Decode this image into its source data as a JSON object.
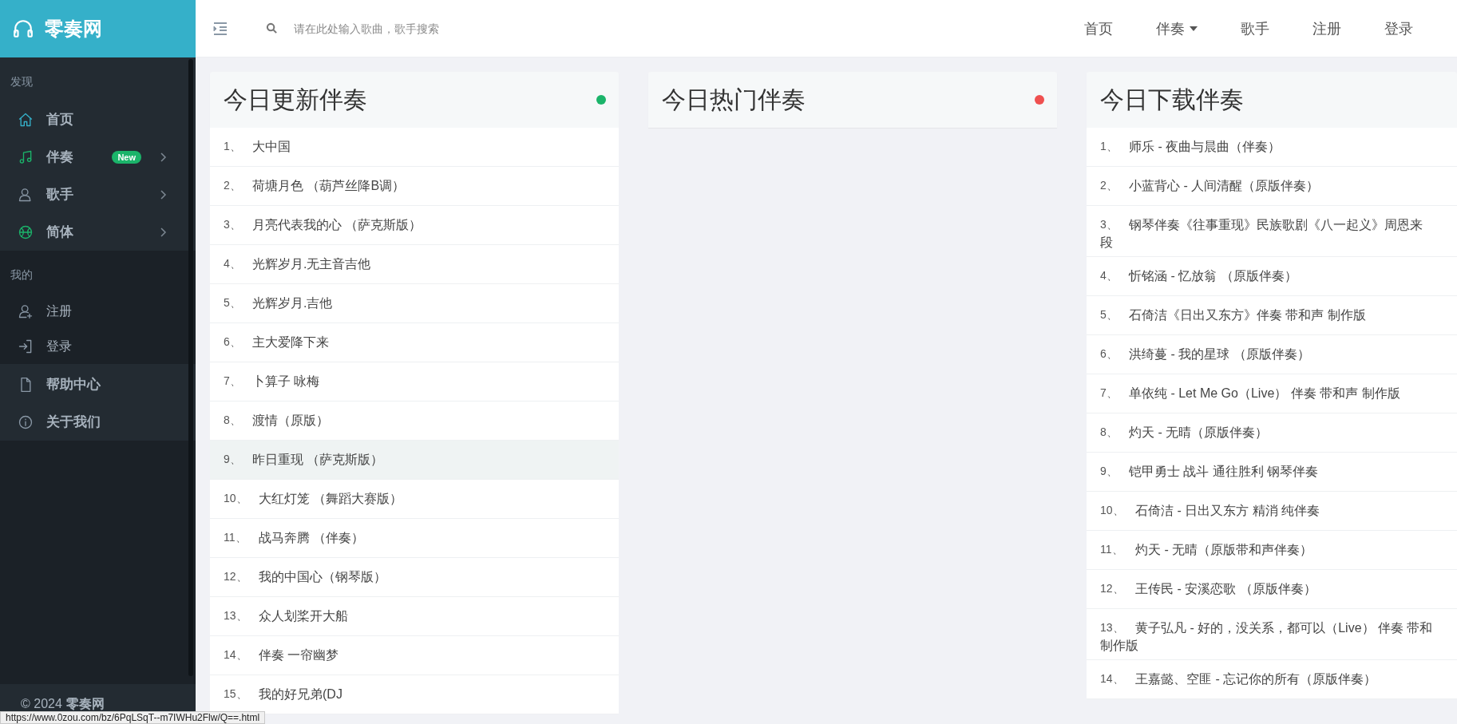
{
  "brand": {
    "name": "零奏网"
  },
  "sidebar": {
    "groups": [
      {
        "kind": "primary",
        "label": "发现",
        "items": [
          {
            "label": "首页",
            "has_submenu": false
          },
          {
            "label": "伴奏",
            "badge": "New",
            "has_submenu": true
          },
          {
            "label": "歌手",
            "has_submenu": true
          },
          {
            "label": "简体",
            "has_submenu": true
          }
        ]
      },
      {
        "kind": "secondary",
        "label": "我的",
        "items": [
          {
            "label": "注册",
            "has_submenu": false
          },
          {
            "label": "登录",
            "has_submenu": false
          }
        ]
      },
      {
        "kind": "primary",
        "items": [
          {
            "label": "帮助中心",
            "has_submenu": false
          },
          {
            "label": "关于我们",
            "has_submenu": false
          }
        ]
      }
    ],
    "footer": {
      "text": "© 2024",
      "brand": "零奏网"
    }
  },
  "header": {
    "search": {
      "placeholder": "请在此处输入歌曲，歌手搜索"
    },
    "nav": [
      {
        "label": "首页",
        "dropdown": false
      },
      {
        "label": "伴奏",
        "dropdown": true
      },
      {
        "label": "歌手",
        "dropdown": false
      },
      {
        "label": "注册",
        "dropdown": false
      },
      {
        "label": "登录",
        "dropdown": false
      }
    ]
  },
  "panels": [
    {
      "title": "今日更新伴奏",
      "color": "#1bb46a",
      "items": [
        {
          "number": "1、",
          "lines": [
            "大中国"
          ],
          "selected": false
        },
        {
          "number": "2、",
          "lines": [
            "荷塘月色 （葫芦丝降B调）"
          ],
          "selected": false
        },
        {
          "number": "3、",
          "lines": [
            "月亮代表我的心 （萨克斯版）"
          ],
          "selected": false
        },
        {
          "number": "4、",
          "lines": [
            "光辉岁月.无主音吉他"
          ],
          "selected": false
        },
        {
          "number": "5、",
          "lines": [
            "光辉岁月.吉他"
          ],
          "selected": false
        },
        {
          "number": "6、",
          "lines": [
            "主大爱降下来"
          ],
          "selected": false
        },
        {
          "number": "7、",
          "lines": [
            "卜算子 咏梅"
          ],
          "selected": false
        },
        {
          "number": "8、",
          "lines": [
            "渡情（原版）"
          ],
          "selected": false
        },
        {
          "number": "9、",
          "lines": [
            "昨日重现 （萨克斯版）"
          ],
          "selected": true
        },
        {
          "number": "10、",
          "lines": [
            "大红灯笼 （舞蹈大赛版）"
          ],
          "selected": false
        },
        {
          "number": "11、",
          "lines": [
            "战马奔腾 （伴奏）"
          ],
          "selected": false
        },
        {
          "number": "12、",
          "lines": [
            "我的中国心（钢琴版）"
          ],
          "selected": false
        },
        {
          "number": "13、",
          "lines": [
            "众人划桨开大船"
          ],
          "selected": false
        },
        {
          "number": "14、",
          "lines": [
            "伴奏 一帘幽梦"
          ],
          "selected": false
        },
        {
          "number": "15、",
          "lines": [
            "我的好兄弟(DJ"
          ],
          "selected": false
        }
      ]
    },
    {
      "title": "今日热门伴奏",
      "color": "#ef5050"
    },
    {
      "title": "今日下载伴奏",
      "items": [
        {
          "number": "1、",
          "lines": [
            "师乐 - 夜曲与晨曲（伴奏）"
          ],
          "selected": false
        },
        {
          "number": "2、",
          "lines": [
            "小蓝背心 - 人间清醒（原版伴奏）"
          ],
          "selected": false
        },
        {
          "number": "3、",
          "lines": [
            "钢琴伴奏《往事重现》民族歌剧《八一起义》周恩来",
            "段"
          ],
          "selected": false
        },
        {
          "number": "4、",
          "lines": [
            "忻铭涵 - 忆放翁 （原版伴奏）"
          ],
          "selected": false
        },
        {
          "number": "5、",
          "lines": [
            "石倚洁《日出又东方》伴奏 带和声 制作版"
          ],
          "selected": false
        },
        {
          "number": "6、",
          "lines": [
            "洪绮蔓 - 我的星球 （原版伴奏）"
          ],
          "selected": false
        },
        {
          "number": "7、",
          "lines": [
            "单依纯 - Let Me Go（Live） 伴奏 带和声 制作版"
          ],
          "selected": false
        },
        {
          "number": "8、",
          "lines": [
            "灼天 - 无晴（原版伴奏）"
          ],
          "selected": false
        },
        {
          "number": "9、",
          "lines": [
            "铠甲勇士 战斗 通往胜利 钢琴伴奏"
          ],
          "selected": false
        },
        {
          "number": "10、",
          "lines": [
            "石倚洁 - 日出又东方 精消 纯伴奏"
          ],
          "selected": false
        },
        {
          "number": "11、",
          "lines": [
            "灼天 - 无晴（原版带和声伴奏）"
          ],
          "selected": false
        },
        {
          "number": "12、",
          "lines": [
            "王传民 - 安溪恋歌 （原版伴奏）"
          ],
          "selected": false
        },
        {
          "number": "13、",
          "lines": [
            "黄子弘凡 - 好的，没关系，都可以（Live） 伴奏 带和",
            "制作版"
          ],
          "selected": false
        },
        {
          "number": "14、",
          "lines": [
            "王嘉懿、空匪 - 忘记你的所有（原版伴奏）"
          ],
          "selected": false
        }
      ]
    }
  ],
  "status_url": "https://www.0zou.com/bz/6PqLSqT--m7IWHu2Flw/Q==.html"
}
